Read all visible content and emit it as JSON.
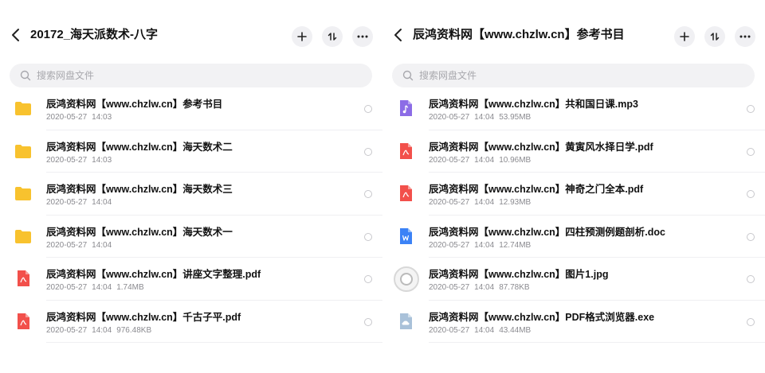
{
  "colors": {
    "folder": "#F8C22E",
    "pdf": "#F2504B",
    "audio": "#8C6CE6",
    "doc": "#3B82F6",
    "exe": "#A9C1D9"
  },
  "left": {
    "title": "20172_海天派数术-八字",
    "search_placeholder": "搜索网盘文件",
    "items": [
      {
        "name": "辰鸿资料网【www.chzlw.cn】参考书目",
        "date": "2020-05-27",
        "time": "14:03",
        "size": "",
        "icon": "folder-icon"
      },
      {
        "name": "辰鸿资料网【www.chzlw.cn】海天数术二",
        "date": "2020-05-27",
        "time": "14:03",
        "size": "",
        "icon": "folder-icon"
      },
      {
        "name": "辰鸿资料网【www.chzlw.cn】海天数术三",
        "date": "2020-05-27",
        "time": "14:04",
        "size": "",
        "icon": "folder-icon"
      },
      {
        "name": "辰鸿资料网【www.chzlw.cn】海天数术一",
        "date": "2020-05-27",
        "time": "14:04",
        "size": "",
        "icon": "folder-icon"
      },
      {
        "name": "辰鸿资料网【www.chzlw.cn】讲座文字整理.pdf",
        "date": "2020-05-27",
        "time": "14:04",
        "size": "1.74MB",
        "icon": "pdf-icon"
      },
      {
        "name": "辰鸿资料网【www.chzlw.cn】千古子平.pdf",
        "date": "2020-05-27",
        "time": "14:04",
        "size": "976.48KB",
        "icon": "pdf-icon"
      }
    ]
  },
  "right": {
    "title": "辰鸿资料网【www.chzlw.cn】参考书目",
    "search_placeholder": "搜索网盘文件",
    "items": [
      {
        "name": "辰鸿资料网【www.chzlw.cn】共和国日课.mp3",
        "date": "2020-05-27",
        "time": "14:04",
        "size": "53.95MB",
        "icon": "audio-file-icon"
      },
      {
        "name": "辰鸿资料网【www.chzlw.cn】黄寅风水择日学.pdf",
        "date": "2020-05-27",
        "time": "14:04",
        "size": "10.96MB",
        "icon": "pdf-icon"
      },
      {
        "name": "辰鸿资料网【www.chzlw.cn】神奇之门全本.pdf",
        "date": "2020-05-27",
        "time": "14:04",
        "size": "12.93MB",
        "icon": "pdf-icon"
      },
      {
        "name": "辰鸿资料网【www.chzlw.cn】四柱预测例题剖析.doc",
        "date": "2020-05-27",
        "time": "14:04",
        "size": "12.74MB",
        "icon": "word-doc-icon"
      },
      {
        "name": "辰鸿资料网【www.chzlw.cn】图片1.jpg",
        "date": "2020-05-27",
        "time": "14:04",
        "size": "87.78KB",
        "icon": "image-thumbnail"
      },
      {
        "name": "辰鸿资料网【www.chzlw.cn】PDF格式浏览器.exe",
        "date": "2020-05-27",
        "time": "14:04",
        "size": "43.44MB",
        "icon": "exe-file-icon"
      }
    ]
  }
}
